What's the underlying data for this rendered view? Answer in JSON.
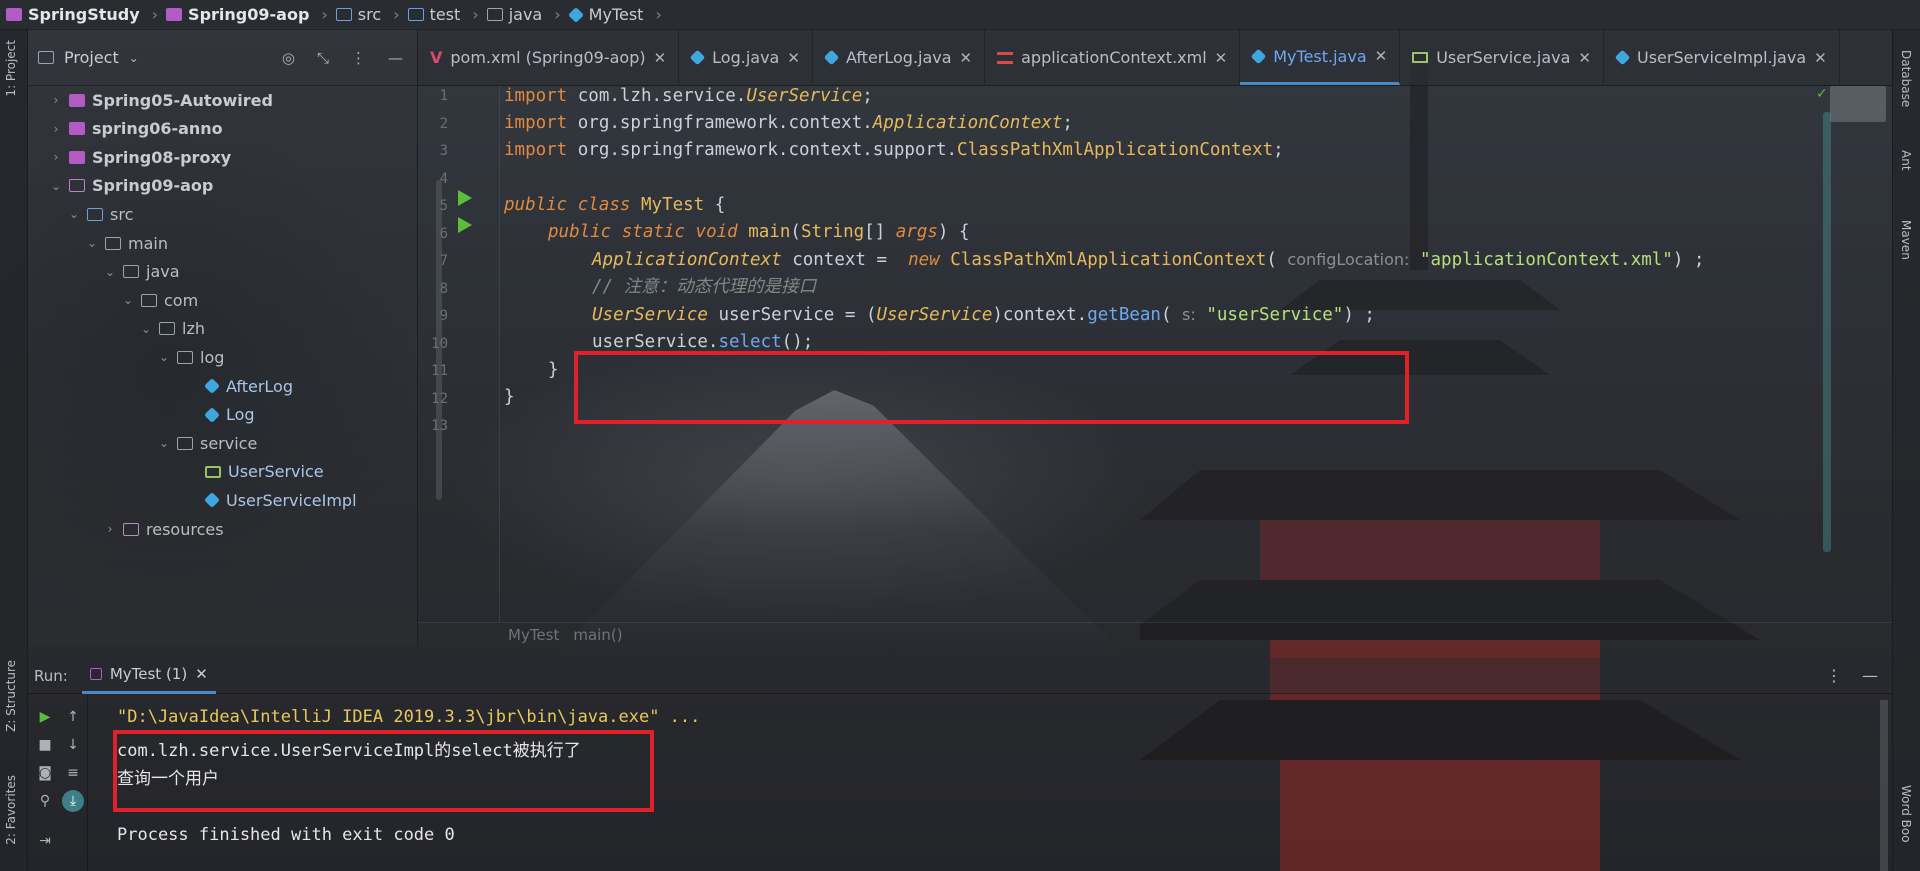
{
  "breadcrumb": [
    {
      "label": "SpringStudy",
      "bold": true,
      "icon": "module-icon"
    },
    {
      "label": "Spring09-aop",
      "bold": true,
      "icon": "module-icon"
    },
    {
      "label": "src",
      "bold": false,
      "icon": "source-folder-icon"
    },
    {
      "label": "test",
      "bold": false,
      "icon": "test-folder-icon"
    },
    {
      "label": "java",
      "bold": false,
      "icon": "folder-icon"
    },
    {
      "label": "MyTest",
      "bold": false,
      "icon": "class-icon"
    }
  ],
  "left_strip": {
    "project_label": "1: Project",
    "structure_label": "Z: Structure",
    "favorites_label": "2: Favorites"
  },
  "right_strip": {
    "database_label": "Database",
    "ant_label": "Ant",
    "maven_label": "Maven",
    "wordbook_label": "Word Boo"
  },
  "project_panel": {
    "title": "Project",
    "tree": [
      {
        "label": "Spring05-Autowired",
        "icon": "module-icon",
        "chev": "›",
        "bold": true
      },
      {
        "label": "spring06-anno",
        "icon": "module-icon",
        "chev": "›",
        "bold": true
      },
      {
        "label": "Spring08-proxy",
        "icon": "module-icon",
        "chev": "›",
        "bold": true
      },
      {
        "label": "Spring09-aop",
        "icon": "module-open-icon",
        "chev": "⌄",
        "bold": true
      },
      {
        "label": "src",
        "icon": "source-folder-icon",
        "chev": "⌄",
        "bold": false
      },
      {
        "label": "main",
        "icon": "folder-icon",
        "chev": "⌄",
        "bold": false
      },
      {
        "label": "java",
        "icon": "folder-icon",
        "chev": "⌄",
        "bold": false
      },
      {
        "label": "com",
        "icon": "folder-icon",
        "chev": "⌄",
        "bold": false
      },
      {
        "label": "lzh",
        "icon": "folder-icon",
        "chev": "⌄",
        "bold": false
      },
      {
        "label": "log",
        "icon": "package-icon",
        "chev": "⌄",
        "bold": false
      },
      {
        "label": "AfterLog",
        "icon": "class-icon",
        "chev": "",
        "bold": false
      },
      {
        "label": "Log",
        "icon": "class-icon",
        "chev": "",
        "bold": false
      },
      {
        "label": "service",
        "icon": "package-icon",
        "chev": "⌄",
        "bold": false
      },
      {
        "label": "UserService",
        "icon": "interface-icon",
        "chev": "",
        "bold": false
      },
      {
        "label": "UserServiceImpl",
        "icon": "class-icon",
        "chev": "",
        "bold": false
      },
      {
        "label": "resources",
        "icon": "resources-folder-icon",
        "chev": "›",
        "bold": false
      }
    ]
  },
  "tabs": [
    {
      "label": "pom.xml (Spring09-aop)",
      "icon": "maven-icon",
      "active": false
    },
    {
      "label": "Log.java",
      "icon": "class-icon",
      "active": false
    },
    {
      "label": "AfterLog.java",
      "icon": "class-icon",
      "active": false
    },
    {
      "label": "applicationContext.xml",
      "icon": "xml-icon",
      "active": false
    },
    {
      "label": "MyTest.java",
      "icon": "class-icon",
      "active": true
    },
    {
      "label": "UserService.java",
      "icon": "interface-icon",
      "active": false
    },
    {
      "label": "UserServiceImpl.java",
      "icon": "class-icon",
      "active": false
    }
  ],
  "code": {
    "line_numbers": [
      "1",
      "2",
      "3",
      "4",
      "5",
      "6",
      "7",
      "8",
      "9",
      "10",
      "11",
      "12",
      "13"
    ],
    "l1": {
      "kw": "import",
      "pkg": " com.lzh.service.",
      "cls": "UserService",
      "end": ";"
    },
    "l2": {
      "kw": "import",
      "pkg": " org.springframework.context.",
      "cls": "ApplicationContext",
      "end": ";"
    },
    "l3": {
      "kw": "import",
      "pkg": " org.springframework.context.support.",
      "cls": "ClassPathXmlApplicationContext",
      "end": ";"
    },
    "l5": {
      "kw1": "public",
      "kw2": "class",
      "name": "MyTest",
      "brace": " {"
    },
    "l6": {
      "kw1": "public",
      "kw2": "static",
      "kw3": "void",
      "name": "main",
      "args_type": "String",
      "rest": "[] ",
      "args": "args",
      "end": ") {"
    },
    "l7": {
      "type": "ApplicationContext",
      "var": " context =  ",
      "new": "new",
      "cls": "ClassPathXmlApplicationContext",
      "open": "( ",
      "hint": "configLocation:",
      "str": "\"applicationContext.xml\"",
      "end": ") ;"
    },
    "l8": {
      "comment": "// 注意：动态代理的是接口"
    },
    "l9": {
      "type": "UserService",
      "var": " userService = (",
      "cast": "UserService",
      "ctx": ")context.",
      "method": "getBean",
      "open": "( ",
      "hint": "s:",
      "str": "\"userService\"",
      "end": ") ;"
    },
    "l10": {
      "obj": "userService.",
      "method": "select",
      "end": "();"
    },
    "l11": "}",
    "l12": "}"
  },
  "editor_breadcrumb": [
    "MyTest",
    "main()"
  ],
  "run_panel": {
    "label": "Run:",
    "tab": "MyTest (1)",
    "lines": [
      "\"D:\\JavaIdea\\IntelliJ IDEA 2019.3.3\\jbr\\bin\\java.exe\" ...",
      "com.lzh.service.UserServiceImpl的select被执行了",
      "查询一个用户",
      "",
      "Process finished with exit code 0"
    ]
  },
  "colors": {
    "highlight": "#e0212b",
    "run_green": "#5bbd3b",
    "keyword": "#e08a40",
    "string": "#b5e07a"
  }
}
